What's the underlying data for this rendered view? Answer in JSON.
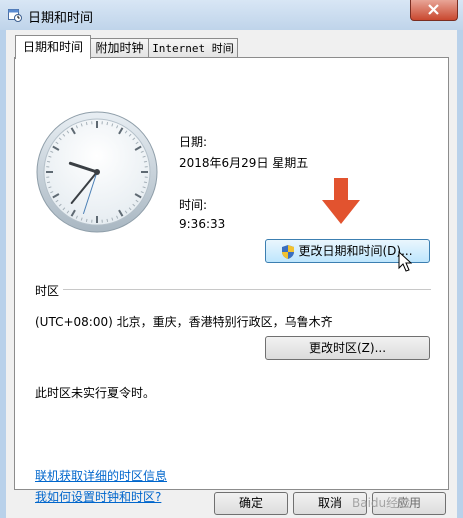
{
  "window": {
    "title": "日期和时间"
  },
  "tabs": [
    {
      "label": "日期和时间",
      "active": true
    },
    {
      "label": "附加时钟",
      "active": false
    },
    {
      "label": "Internet 时间",
      "active": false
    }
  ],
  "date": {
    "label": "日期:",
    "value": "2018年6月29日 星期五"
  },
  "time": {
    "label": "时间:",
    "value": "9:36:33"
  },
  "clock": {
    "hour": 9,
    "minute": 36,
    "second": 33
  },
  "buttons": {
    "change_datetime": "更改日期和时间(D)...",
    "change_timezone": "更改时区(Z)...",
    "ok": "确定",
    "cancel": "取消",
    "apply": "应用"
  },
  "timezone": {
    "heading": "时区",
    "value": "(UTC+08:00) 北京，重庆，香港特别行政区，乌鲁木齐",
    "dst_note": "此时区未实行夏令时。"
  },
  "links": {
    "online_info": "联机获取详细的时区信息",
    "how_to": "我如何设置时钟和时区?"
  },
  "watermark": "Baidu经验",
  "colors": {
    "arrow": "#e2532f",
    "link": "#0066cc"
  }
}
